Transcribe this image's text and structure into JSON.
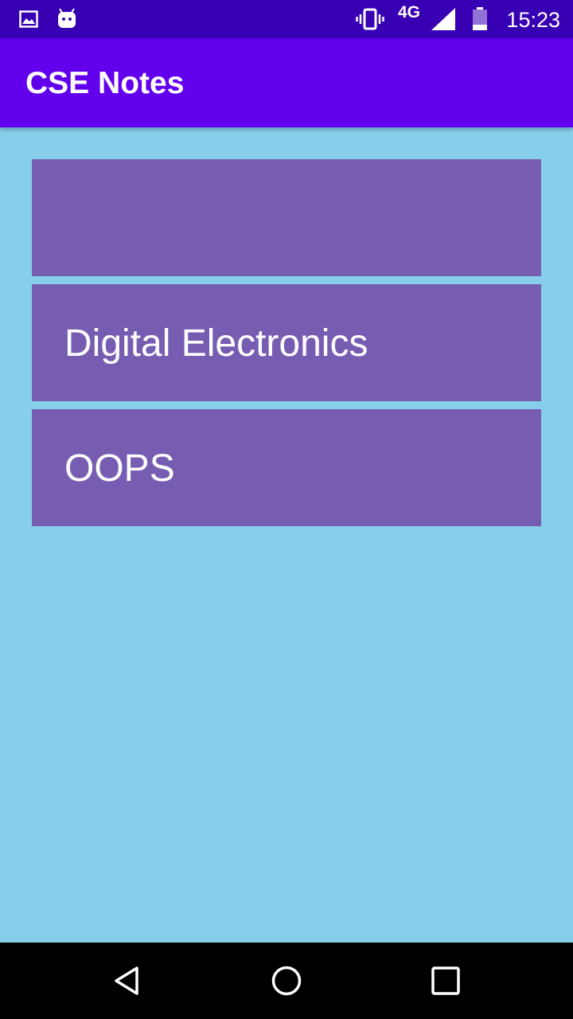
{
  "status_bar": {
    "time": "15:23",
    "network": "4G",
    "icons": [
      "image-icon",
      "android-icon",
      "vibrate-icon",
      "signal-icon",
      "battery-icon"
    ]
  },
  "app_bar": {
    "title": "CSE Notes",
    "color": "#6200ee"
  },
  "subjects": [
    {
      "label": ""
    },
    {
      "label": "Digital Electronics"
    },
    {
      "label": "OOPS"
    }
  ],
  "colors": {
    "status_bar": "#3700b3",
    "background": "#87ceeb",
    "card": "#775db2"
  },
  "nav_bar": {
    "buttons": [
      "back-icon",
      "home-icon",
      "recents-icon"
    ]
  }
}
